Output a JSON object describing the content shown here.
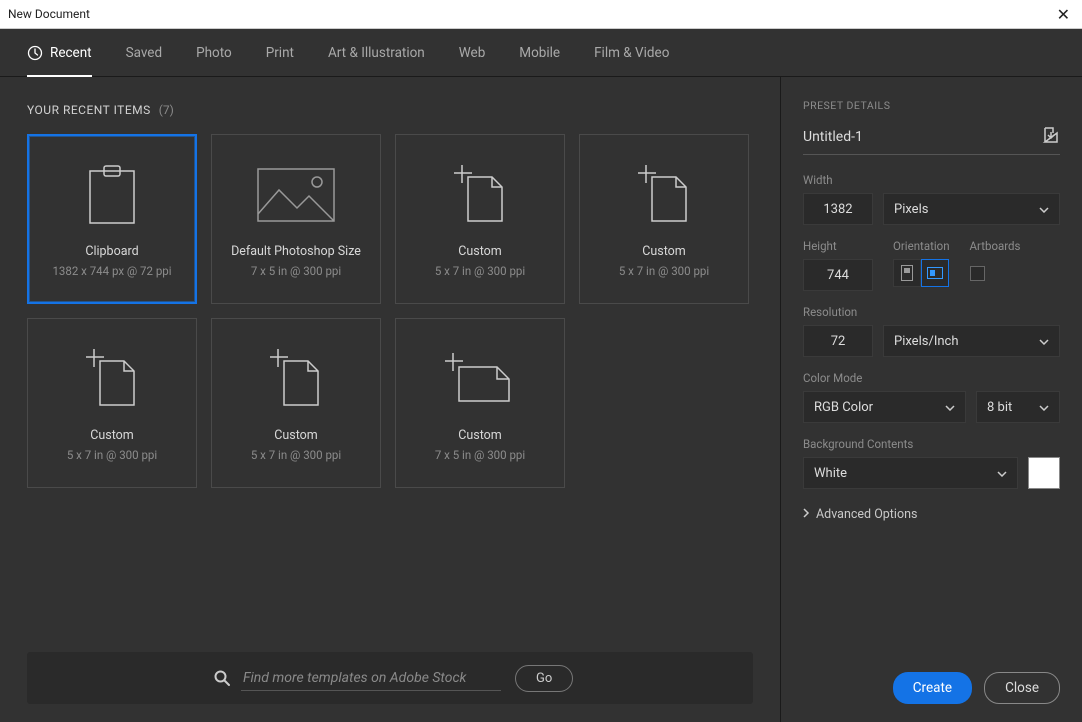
{
  "titlebar": {
    "title": "New Document"
  },
  "tabs": {
    "items": [
      {
        "label": "Recent"
      },
      {
        "label": "Saved"
      },
      {
        "label": "Photo"
      },
      {
        "label": "Print"
      },
      {
        "label": "Art & Illustration"
      },
      {
        "label": "Web"
      },
      {
        "label": "Mobile"
      },
      {
        "label": "Film & Video"
      }
    ]
  },
  "section": {
    "label": "YOUR RECENT ITEMS",
    "count": "(7)"
  },
  "presets": [
    {
      "title": "Clipboard",
      "sub": "1382 x 744 px @ 72 ppi"
    },
    {
      "title": "Default Photoshop Size",
      "sub": "7 x 5 in @ 300 ppi"
    },
    {
      "title": "Custom",
      "sub": "5 x 7 in @ 300 ppi"
    },
    {
      "title": "Custom",
      "sub": "5 x 7 in @ 300 ppi"
    },
    {
      "title": "Custom",
      "sub": "5 x 7 in @ 300 ppi"
    },
    {
      "title": "Custom",
      "sub": "5 x 7 in @ 300 ppi"
    },
    {
      "title": "Custom",
      "sub": "7 x 5 in @ 300 ppi"
    }
  ],
  "search": {
    "placeholder": "Find more templates on Adobe Stock",
    "go": "Go"
  },
  "details": {
    "header": "PRESET DETAILS",
    "name": "Untitled-1",
    "labels": {
      "width": "Width",
      "height": "Height",
      "orientation": "Orientation",
      "artboards": "Artboards",
      "resolution": "Resolution",
      "color_mode": "Color Mode",
      "background": "Background Contents",
      "advanced": "Advanced Options"
    },
    "width": "1382",
    "width_unit": "Pixels",
    "height": "744",
    "resolution": "72",
    "resolution_unit": "Pixels/Inch",
    "color_mode": "RGB Color",
    "bit_depth": "8 bit",
    "background": "White"
  },
  "actions": {
    "create": "Create",
    "close": "Close"
  }
}
